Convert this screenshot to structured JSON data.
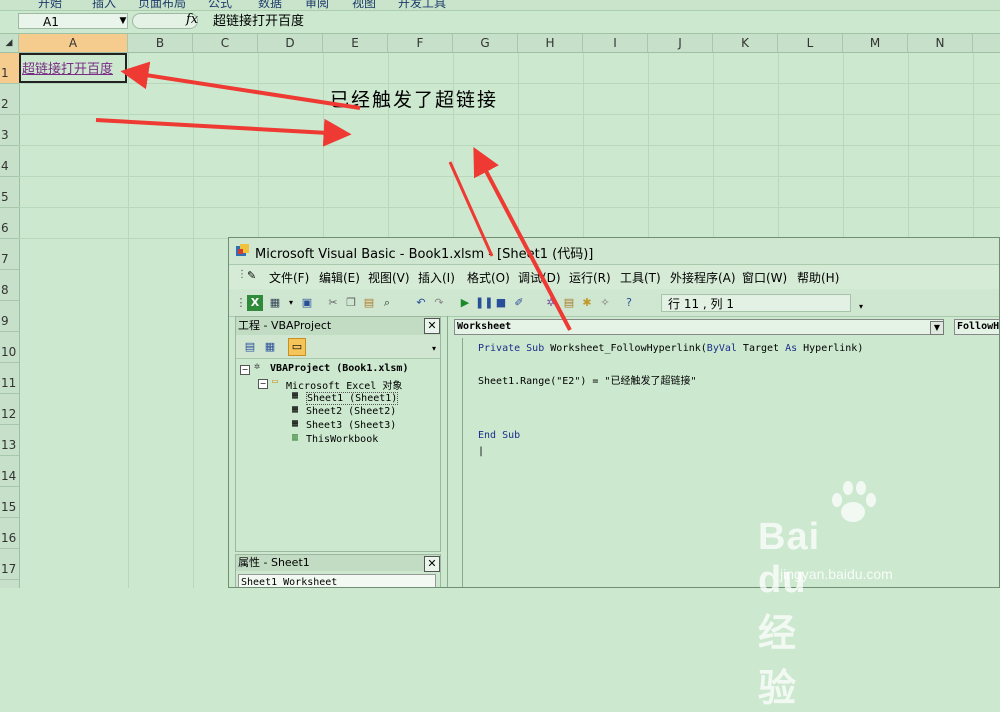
{
  "ribbon": {
    "tabs": [
      "开始",
      "插入",
      "页面布局",
      "公式",
      "数据",
      "审阅",
      "视图",
      "开发工具"
    ]
  },
  "formula_bar": {
    "name_box": "A1",
    "fx": "fx",
    "formula": "超链接打开百度"
  },
  "sheet": {
    "columns": [
      "A",
      "B",
      "C",
      "D",
      "E",
      "F",
      "G",
      "H",
      "I",
      "J",
      "K",
      "L",
      "M",
      "N"
    ],
    "rows": [
      "1",
      "2",
      "3",
      "4",
      "5",
      "6",
      "7",
      "8",
      "9",
      "10",
      "11",
      "12",
      "13",
      "14",
      "15",
      "16",
      "17"
    ],
    "a1_value": "超链接打开百度",
    "annotation": "已经触发了超链接"
  },
  "vbe": {
    "title": "Microsoft Visual Basic - Book1.xlsm - [Sheet1 (代码)]",
    "menu": [
      "文件(F)",
      "编辑(E)",
      "视图(V)",
      "插入(I)",
      "格式(O)",
      "调试(D)",
      "运行(R)",
      "工具(T)",
      "外接程序(A)",
      "窗口(W)",
      "帮助(H)"
    ],
    "position": "行 11 , 列 1",
    "project_pane": {
      "title": "工程 - VBAProject",
      "tree": [
        "VBAProject (Book1.xlsm)",
        "Microsoft Excel 对象",
        "Sheet1 (Sheet1)",
        "Sheet2 (Sheet2)",
        "Sheet3 (Sheet3)",
        "ThisWorkbook"
      ]
    },
    "properties_pane": {
      "title": "属性 - Sheet1",
      "combo": "Sheet1 Worksheet"
    },
    "code": {
      "object": "Worksheet",
      "procedure": "FollowHyperlink",
      "line1_kw1": "Private Sub",
      "line1_mid": " Worksheet_FollowHyperlink(",
      "line1_kw2": "ByVal",
      "line1_mid2": " Target ",
      "line1_kw3": "As",
      "line1_end": " Hyperlink)",
      "line2": "Sheet1.Range(\"E2\") = \"已经触发了超链接\"",
      "line3": "End Sub",
      "cursor": "|"
    }
  },
  "watermark": {
    "logo": "Bai du 经验",
    "url": "jingyan.baidu.com"
  },
  "colors": {
    "sheet_bg": "#cce8cf",
    "selected_header": "#f6cc8e",
    "link": "#7a2b86",
    "arrow": "#ee3a33",
    "keyword": "#1b2e8a"
  }
}
